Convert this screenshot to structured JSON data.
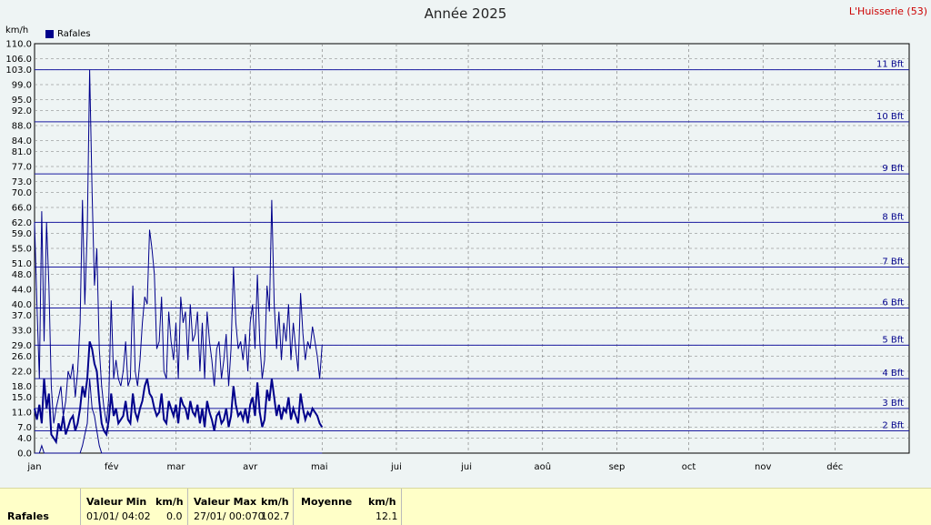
{
  "title": "Année 2025",
  "location": "L'Huisserie (53)",
  "unit_label": "km/h",
  "legend": {
    "label": "Rafales",
    "color": "#00008b"
  },
  "chart_data": {
    "type": "line",
    "title": "Année 2025",
    "ylabel": "km/h",
    "ylim": [
      0,
      110
    ],
    "y_ticks": [
      "0.0",
      "4.0",
      "7.0",
      "11.0",
      "15.0",
      "18.0",
      "22.0",
      "26.0",
      "29.0",
      "33.0",
      "37.0",
      "40.0",
      "44.0",
      "48.0",
      "51.0",
      "55.0",
      "59.0",
      "62.0",
      "66.0",
      "70.0",
      "73.0",
      "77.0",
      "81.0",
      "84.0",
      "88.0",
      "92.0",
      "95.0",
      "99.0",
      "103.0",
      "106.0",
      "110.0"
    ],
    "x_ticks": [
      "jan",
      "fév",
      "mar",
      "avr",
      "mai",
      "jui",
      "jui",
      "aoû",
      "sep",
      "oct",
      "nov",
      "déc"
    ],
    "beaufort": [
      {
        "label": "2 Bft",
        "value": 6
      },
      {
        "label": "3 Bft",
        "value": 12
      },
      {
        "label": "4 Bft",
        "value": 20
      },
      {
        "label": "5 Bft",
        "value": 29
      },
      {
        "label": "6 Bft",
        "value": 39
      },
      {
        "label": "7 Bft",
        "value": 50
      },
      {
        "label": "8 Bft",
        "value": 62
      },
      {
        "label": "9 Bft",
        "value": 75
      },
      {
        "label": "10 Bft",
        "value": 89
      },
      {
        "label": "11 Bft",
        "value": 103
      }
    ],
    "grid": true,
    "legend_position": "top-left",
    "series": [
      {
        "name": "Rafales",
        "color": "#00008b",
        "x": [
          1,
          2,
          3,
          4,
          5,
          6,
          7,
          8,
          9,
          10,
          11,
          12,
          13,
          14,
          15,
          16,
          17,
          18,
          19,
          20,
          21,
          22,
          23,
          24,
          25,
          26,
          27,
          28,
          29,
          30,
          31,
          32,
          33,
          34,
          35,
          36,
          37,
          38,
          39,
          40,
          41,
          42,
          43,
          44,
          45,
          46,
          47,
          48,
          49,
          50,
          51,
          52,
          53,
          54,
          55,
          56,
          57,
          58,
          59,
          60,
          61,
          62,
          63,
          64,
          65,
          66,
          67,
          68,
          69,
          70,
          71,
          72,
          73,
          74,
          75,
          76,
          77,
          78,
          79,
          80,
          81,
          82,
          83,
          84,
          85,
          86,
          87,
          88,
          89,
          90,
          91,
          92,
          93,
          94,
          95,
          96,
          97,
          98,
          99,
          100,
          101,
          102,
          103,
          104,
          105,
          106,
          107,
          108,
          109,
          110,
          111,
          112,
          113,
          114,
          115,
          116,
          117,
          118,
          119,
          120,
          121
        ],
        "max": [
          62,
          40,
          20,
          65,
          30,
          62,
          45,
          18,
          8,
          12,
          15,
          18,
          10,
          14,
          22,
          20,
          24,
          15,
          22,
          35,
          68,
          40,
          60,
          103,
          70,
          45,
          55,
          28,
          18,
          12,
          8,
          15,
          41,
          20,
          25,
          20,
          18,
          22,
          30,
          18,
          20,
          45,
          22,
          18,
          25,
          35,
          42,
          40,
          60,
          55,
          48,
          28,
          30,
          42,
          22,
          20,
          38,
          30,
          25,
          35,
          20,
          42,
          35,
          38,
          25,
          40,
          30,
          32,
          38,
          22,
          35,
          20,
          38,
          30,
          25,
          18,
          28,
          30,
          20,
          25,
          32,
          18,
          28,
          50,
          35,
          28,
          30,
          25,
          32,
          22,
          35,
          40,
          28,
          48,
          30,
          20,
          25,
          45,
          38,
          68,
          40,
          28,
          38,
          25,
          35,
          30,
          40,
          25,
          35,
          28,
          22,
          43,
          32,
          25,
          30,
          28,
          34,
          30,
          26,
          20,
          29
        ],
        "mean": [
          12,
          9,
          13,
          8,
          20,
          12,
          16,
          5,
          4,
          3,
          8,
          6,
          10,
          5,
          7,
          9,
          10,
          6,
          8,
          12,
          18,
          15,
          20,
          30,
          28,
          24,
          22,
          14,
          8,
          6,
          5,
          9,
          16,
          10,
          12,
          8,
          9,
          10,
          14,
          9,
          8,
          16,
          11,
          9,
          12,
          14,
          18,
          20,
          16,
          15,
          12,
          10,
          11,
          16,
          9,
          8,
          14,
          12,
          10,
          13,
          8,
          15,
          13,
          12,
          9,
          14,
          11,
          10,
          13,
          8,
          12,
          7,
          14,
          11,
          9,
          6,
          10,
          11,
          8,
          9,
          12,
          7,
          10,
          18,
          13,
          10,
          11,
          9,
          12,
          8,
          13,
          15,
          10,
          19,
          11,
          7,
          9,
          17,
          14,
          20,
          15,
          10,
          13,
          9,
          12,
          11,
          15,
          9,
          12,
          10,
          8,
          16,
          12,
          9,
          11,
          10,
          12,
          11,
          10,
          8,
          7
        ],
        "min": [
          0,
          0,
          0,
          2,
          0,
          0,
          0,
          0,
          0,
          0,
          0,
          0,
          0,
          0,
          0,
          0,
          0,
          0,
          0,
          0,
          2,
          5,
          8,
          20,
          12,
          10,
          6,
          2,
          0,
          0,
          0,
          0,
          0,
          0,
          0,
          0,
          0,
          0,
          0,
          0,
          0,
          0,
          0,
          0,
          0,
          0,
          0,
          0,
          0,
          0,
          0,
          0,
          0,
          0,
          0,
          0,
          0,
          0,
          0,
          0,
          0,
          0,
          0,
          0,
          0,
          0,
          0,
          0,
          0,
          0,
          0,
          0,
          0,
          0,
          0,
          0,
          0,
          0,
          0,
          0,
          0,
          0,
          0,
          0,
          0,
          0,
          0,
          0,
          0,
          0,
          0,
          0,
          0,
          0,
          0,
          0,
          0,
          0,
          0,
          0,
          0,
          0,
          0,
          0,
          0,
          0,
          0,
          0,
          0,
          0,
          0,
          0,
          0,
          0,
          0,
          0,
          0,
          0,
          0,
          0,
          0
        ]
      }
    ]
  },
  "footer": {
    "row_label": "Rafales",
    "min_header": "Valeur Min",
    "min_unit": "km/h",
    "min_date": "01/01/ 04:02",
    "min_value": "0.0",
    "max_header": "Valeur Max",
    "max_unit": "km/h",
    "max_date": "27/01/ 00:070",
    "max_value": "102.7",
    "avg_header": "Moyenne",
    "avg_unit": "km/h",
    "avg_value": "12.1"
  }
}
